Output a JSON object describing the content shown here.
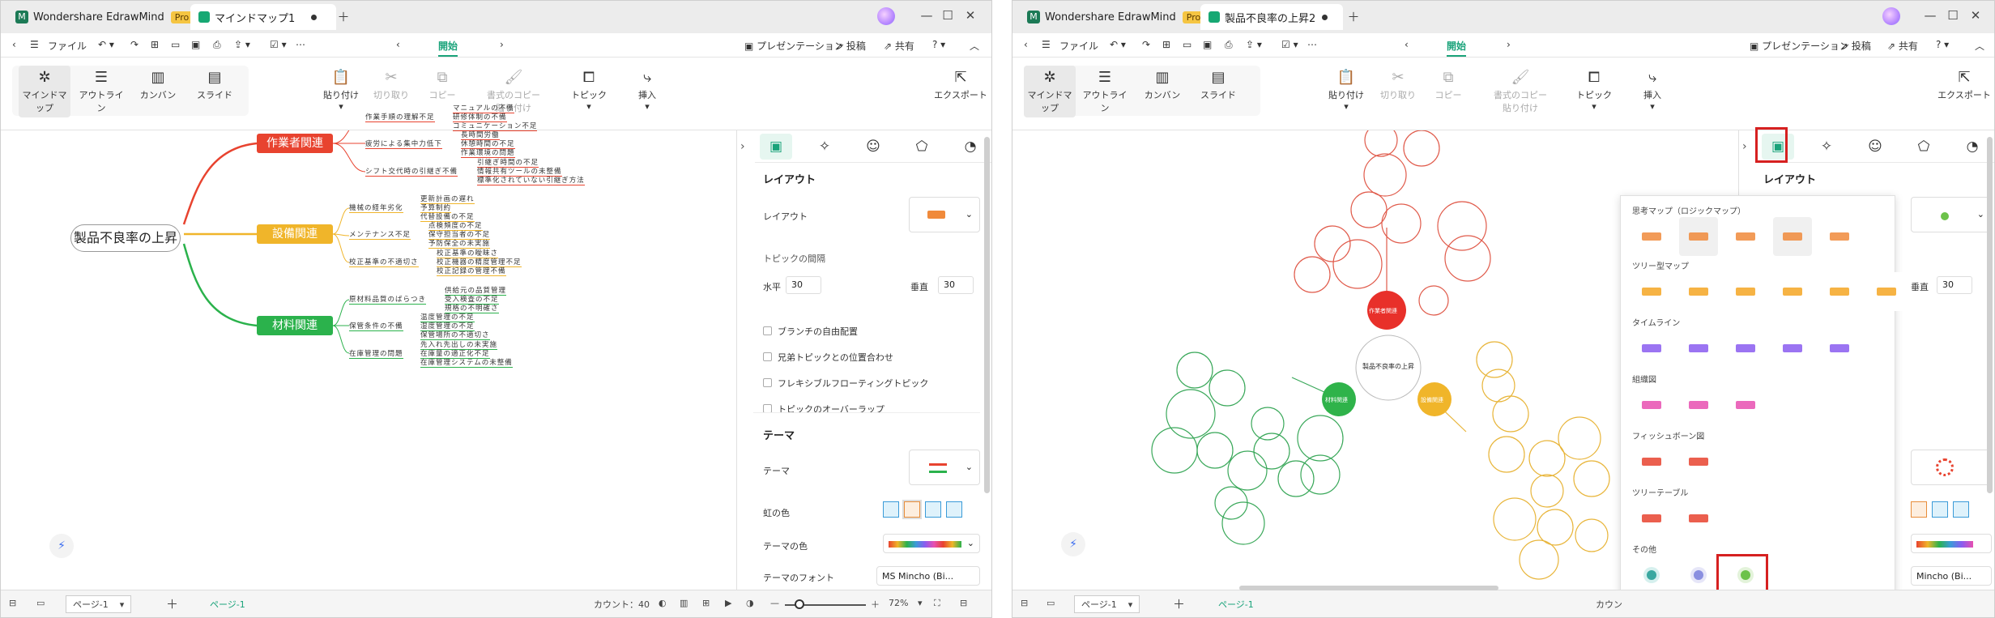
{
  "app": {
    "name": "Wondershare EdrawMind",
    "badge": "Pro"
  },
  "left": {
    "doc_tab": "マインドマップ1",
    "menu": {
      "file": "ファイル",
      "start": "開始",
      "presentation": "プレゼンテーション",
      "post": "投稿",
      "share": "共有"
    },
    "ribbon": {
      "mindmap": "マインドマップ",
      "outline": "アウトライン",
      "kanban": "カンバン",
      "slide": "スライド",
      "paste": "貼り付け",
      "cut": "切り取り",
      "copy": "コピー",
      "format_copy_1": "書式のコピー",
      "format_copy_2": "貼り付け",
      "topic": "トピック",
      "insert": "挿入",
      "export": "エクスポート"
    },
    "mindmap": {
      "root": "製品不良率の上昇",
      "branches": [
        {
          "label": "作業者関連",
          "color": "#e8432f",
          "subs": [
            {
              "label": "作業手順の理解不足",
              "leaves": [
                "マニュアルの不備",
                "研修体制の不備",
                "コミュニケーション不足"
              ]
            },
            {
              "label": "疲労による集中力低下",
              "leaves": [
                "長時間労働",
                "休憩時間の不足",
                "作業環境の問題"
              ]
            },
            {
              "label": "シフト交代時の引継ぎ不備",
              "leaves": [
                "引継ぎ時間の不足",
                "情報共有ツールの未整備",
                "標準化されていない引継ぎ方法"
              ]
            }
          ]
        },
        {
          "label": "設備関連",
          "color": "#f0b52a",
          "subs": [
            {
              "label": "機械の経年劣化",
              "leaves": [
                "更新計画の遅れ",
                "予算制約",
                "代替設備の不足"
              ]
            },
            {
              "label": "メンテナンス不足",
              "leaves": [
                "点検頻度の不足",
                "保守担当者の不足",
                "予防保全の未実施"
              ]
            },
            {
              "label": "校正基準の不適切さ",
              "leaves": [
                "校正基準の曖昧さ",
                "校正機器の精度管理不足",
                "校正記録の管理不備"
              ]
            }
          ]
        },
        {
          "label": "材料関連",
          "color": "#2bb24c",
          "subs": [
            {
              "label": "原材料品質のばらつき",
              "leaves": [
                "供給元の品質管理",
                "受入検査の不足",
                "規格の不明確さ"
              ]
            },
            {
              "label": "保管条件の不備",
              "leaves": [
                "温度管理の不足",
                "湿度管理の不足",
                "保管場所の不適切さ"
              ]
            },
            {
              "label": "在庫管理の問題",
              "leaves": [
                "先入れ先出しの未実施",
                "在庫量の適正化不足",
                "在庫管理システムの未整備"
              ]
            }
          ]
        }
      ]
    },
    "panel": {
      "layout_header": "レイアウト",
      "layout_label": "レイアウト",
      "topic_spacing": "トピックの間隔",
      "horizontal": "水平",
      "horizontal_value": "30",
      "vertical": "垂直",
      "vertical_value": "30",
      "options": [
        "ブランチの自由配置",
        "兄弟トピックとの位置合わせ",
        "フレキシブルフローティングトピック",
        "トピックのオーバーラップ"
      ],
      "theme_header": "テーマ",
      "theme": "テーマ",
      "rainbow": "虹の色",
      "theme_color": "テーマの色",
      "theme_font": "テーマのフォント",
      "font_value": "MS Mincho (Bi..."
    },
    "status": {
      "page_select": "ページ-1",
      "page_tab": "ページ-1",
      "count": "カウント：40",
      "zoom": "72%"
    }
  },
  "right": {
    "doc_tab": "製品不良率の上昇2",
    "bubble": {
      "root": "製品不良率の上昇",
      "branches": [
        {
          "label": "作業者関連",
          "color": "#e8302a"
        },
        {
          "label": "材料関連",
          "color": "#2fb34a"
        },
        {
          "label": "設備関連",
          "color": "#f0b52a"
        }
      ]
    },
    "panel": {
      "layout_header": "レイアウト",
      "vertical_value": "30",
      "font_value": "Mincho (Bi..."
    },
    "popup": {
      "categories": [
        "思考マップ（ロジックマップ）",
        "ツリー型マップ",
        "タイムライン",
        "組織図",
        "フィッシュボーン図",
        "ツリーテーブル",
        "その他"
      ]
    },
    "status": {
      "page_select": "ページ-1",
      "page_tab": "ページ-1",
      "count": "カウン"
    }
  },
  "colors": {
    "accent": "#1aa37a",
    "highlight": "#d62020"
  }
}
